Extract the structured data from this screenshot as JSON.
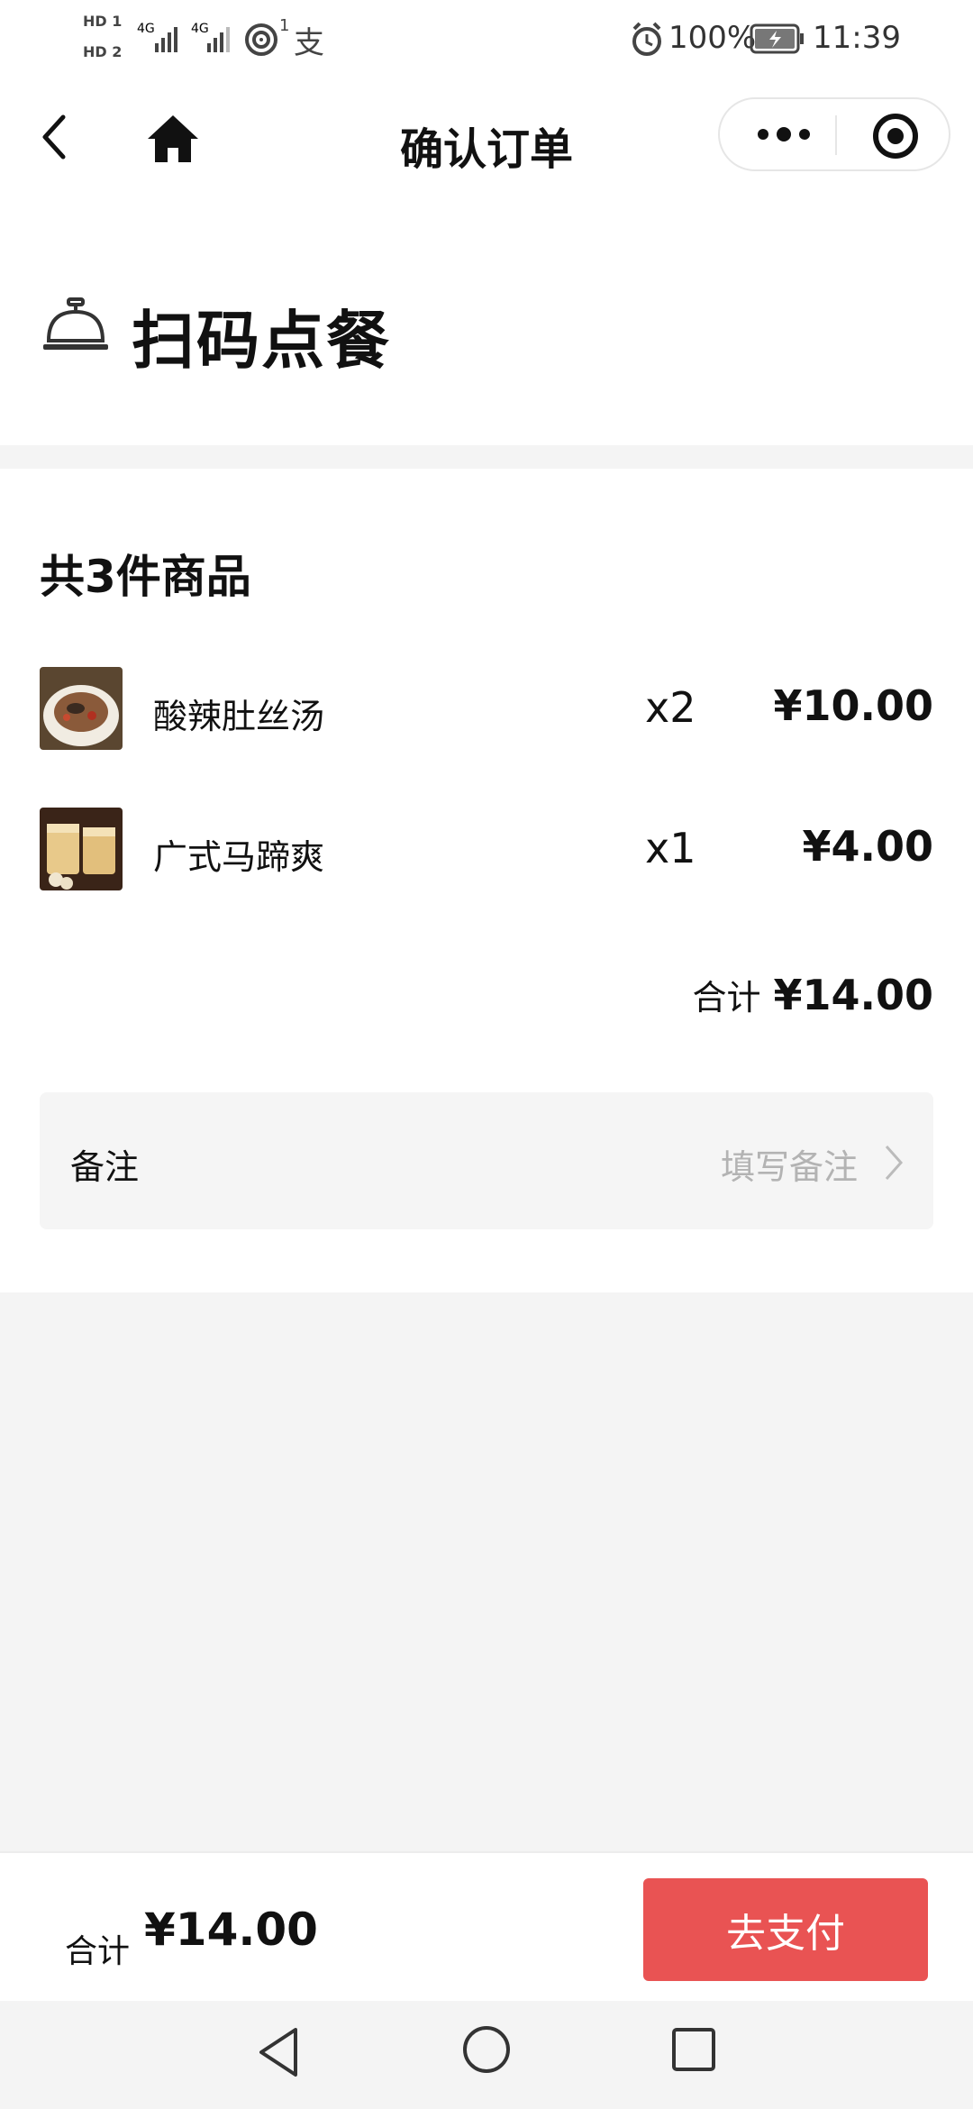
{
  "status_bar": {
    "hd1": "HD 1",
    "hd2": "HD 2",
    "net1": "4G",
    "net2": "4G",
    "hotspot_count": "1",
    "pay_glyph": "支",
    "battery": "100%",
    "time": "11:39",
    "icons": [
      "alarm-icon",
      "battery-icon",
      "signal-icon",
      "hotspot-icon"
    ]
  },
  "nav": {
    "title": "确认订单",
    "icons": [
      "back-icon",
      "home-icon",
      "more-icon",
      "target-icon"
    ]
  },
  "scan": {
    "title": "扫码点餐",
    "icon": "bell-icon"
  },
  "order": {
    "count_label": "共3件商品",
    "items": [
      {
        "name": "酸辣肚丝汤",
        "qty": "x2",
        "price": "¥10.00",
        "thumb": "soup-thumbnail"
      },
      {
        "name": "广式马蹄爽",
        "qty": "x1",
        "price": "¥4.00",
        "thumb": "drink-thumbnail"
      }
    ],
    "subtotal_label": "合计",
    "subtotal_value": "¥14.00",
    "note_label": "备注",
    "note_placeholder": "填写备注"
  },
  "pay_bar": {
    "total_label": "合计",
    "total_value": "¥14.00",
    "button_label": "去支付",
    "accent": "#e95353"
  },
  "system_nav": {
    "icons": [
      "back-triangle-icon",
      "home-circle-icon",
      "recents-square-icon"
    ]
  }
}
